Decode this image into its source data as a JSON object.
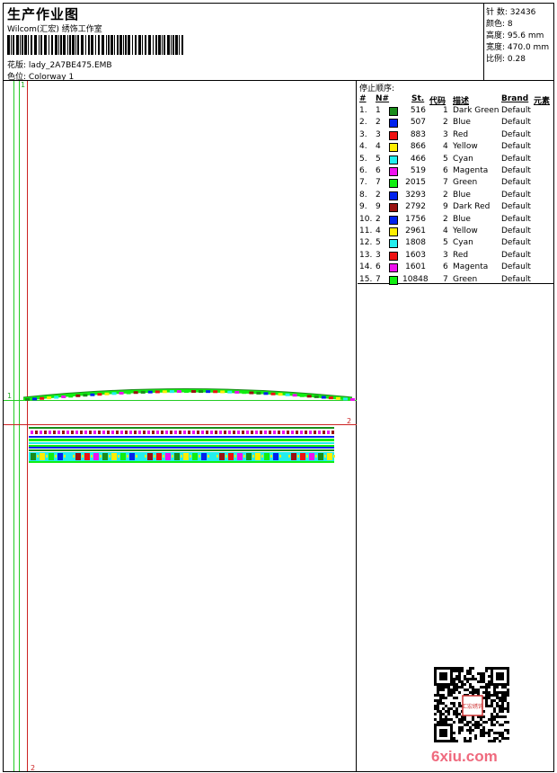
{
  "header": {
    "title": "生产作业图",
    "company": "Wilcom(汇宏) 绣饰工作室",
    "design_label": "花版:",
    "design_value": "lady_2A7BE475.EMB",
    "colorway_label": "色位:",
    "colorway_value": "Colorway 1"
  },
  "stats": [
    {
      "label": "针 数:",
      "value": "32436"
    },
    {
      "label": "颜色:",
      "value": "8"
    },
    {
      "label": "高度:",
      "value": "95.6 mm"
    },
    {
      "label": "宽度:",
      "value": "470.0 mm"
    },
    {
      "label": "比例:",
      "value": "0.28"
    }
  ],
  "markers": {
    "top_one": "1",
    "left_one": "1",
    "right_two": "2",
    "bottom_two": "2"
  },
  "sequence": {
    "title": "停止顺序:",
    "headers": {
      "idx": "#",
      "needle": "N#",
      "stitches": "St.",
      "code": "代码",
      "desc": "描述",
      "brand": "Brand",
      "element": "元素"
    },
    "rows": [
      {
        "idx": "1.",
        "needle": "1",
        "stitches": "516",
        "code": "1",
        "desc": "Dark Green",
        "brand": "Default",
        "color": "#1a8c1a"
      },
      {
        "idx": "2.",
        "needle": "2",
        "stitches": "507",
        "code": "2",
        "desc": "Blue",
        "brand": "Default",
        "color": "#0022ee"
      },
      {
        "idx": "3.",
        "needle": "3",
        "stitches": "883",
        "code": "3",
        "desc": "Red",
        "brand": "Default",
        "color": "#ee1111"
      },
      {
        "idx": "4.",
        "needle": "4",
        "stitches": "866",
        "code": "4",
        "desc": "Yellow",
        "brand": "Default",
        "color": "#ffee00"
      },
      {
        "idx": "5.",
        "needle": "5",
        "stitches": "466",
        "code": "5",
        "desc": "Cyan",
        "brand": "Default",
        "color": "#22eeee"
      },
      {
        "idx": "6.",
        "needle": "6",
        "stitches": "519",
        "code": "6",
        "desc": "Magenta",
        "brand": "Default",
        "color": "#ee11ee"
      },
      {
        "idx": "7.",
        "needle": "7",
        "stitches": "2015",
        "code": "7",
        "desc": "Green",
        "brand": "Default",
        "color": "#11ee11"
      },
      {
        "idx": "8.",
        "needle": "2",
        "stitches": "3293",
        "code": "2",
        "desc": "Blue",
        "brand": "Default",
        "color": "#0022ee"
      },
      {
        "idx": "9.",
        "needle": "9",
        "stitches": "2792",
        "code": "9",
        "desc": "Dark Red",
        "brand": "Default",
        "color": "#991111"
      },
      {
        "idx": "10.",
        "needle": "2",
        "stitches": "1756",
        "code": "2",
        "desc": "Blue",
        "brand": "Default",
        "color": "#0022ee"
      },
      {
        "idx": "11.",
        "needle": "4",
        "stitches": "2961",
        "code": "4",
        "desc": "Yellow",
        "brand": "Default",
        "color": "#ffee00"
      },
      {
        "idx": "12.",
        "needle": "5",
        "stitches": "1808",
        "code": "5",
        "desc": "Cyan",
        "brand": "Default",
        "color": "#22eeee"
      },
      {
        "idx": "13.",
        "needle": "3",
        "stitches": "1603",
        "code": "3",
        "desc": "Red",
        "brand": "Default",
        "color": "#ee1111"
      },
      {
        "idx": "14.",
        "needle": "6",
        "stitches": "1601",
        "code": "6",
        "desc": "Magenta",
        "brand": "Default",
        "color": "#ee11ee"
      },
      {
        "idx": "15.",
        "needle": "7",
        "stitches": "10848",
        "code": "7",
        "desc": "Green",
        "brand": "Default",
        "color": "#11ee11"
      }
    ]
  },
  "watermark": "6xiu.com",
  "qr_stamp_text": "汇宏绣饰"
}
